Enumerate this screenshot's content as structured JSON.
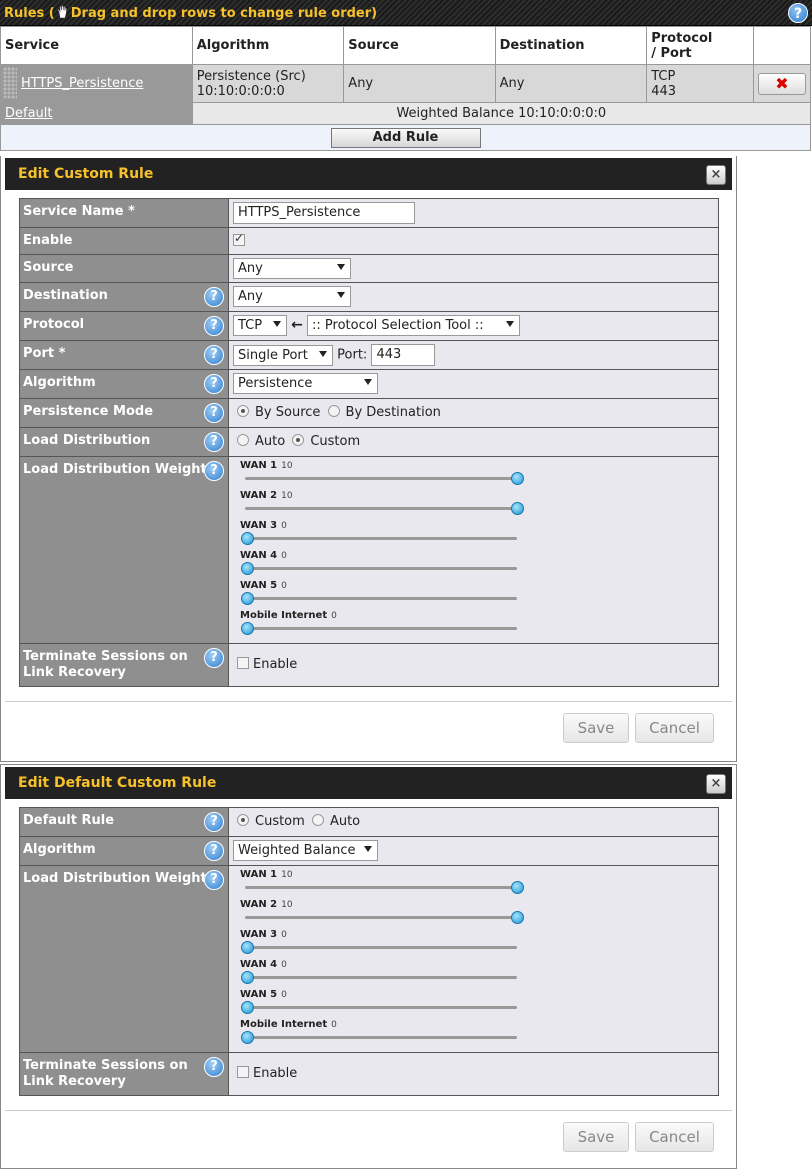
{
  "rules_bar": {
    "title": "Rules",
    "hint": "Drag and drop rows to change rule order",
    "help": "?"
  },
  "rules_table": {
    "headers": [
      "Service",
      "Algorithm",
      "Source",
      "Destination",
      "Protocol / Port"
    ],
    "header_protocol_line1": "Protocol",
    "header_protocol_line2": "/ Port",
    "rows": [
      {
        "service": "HTTPS_Persistence",
        "algorithm_line1": "Persistence (Src)",
        "algorithm_line2": "10:10:0:0:0:0",
        "source": "Any",
        "destination": "Any",
        "protocol": "TCP",
        "port": "443",
        "delete": "✖"
      }
    ],
    "default_label": "Default",
    "default_value": "Weighted Balance 10:10:0:0:0:0",
    "add_rule": "Add Rule"
  },
  "custom_rule": {
    "title": "Edit Custom Rule",
    "close": "×",
    "labels": {
      "service_name": "Service Name *",
      "enable": "Enable",
      "source": "Source",
      "destination": "Destination",
      "protocol": "Protocol",
      "port": "Port *",
      "algorithm": "Algorithm",
      "persistence_mode": "Persistence Mode",
      "load_distribution": "Load Distribution",
      "load_distribution_weight": "Load Distribution Weight",
      "terminate_line1": "Terminate Sessions on",
      "terminate_line2": "Link Recovery"
    },
    "values": {
      "service_name": "HTTPS_Persistence",
      "enable_checked": true,
      "source": "Any",
      "destination": "Any",
      "protocol": "TCP",
      "protocol_arrow": "🡐",
      "protocol_tool": ":: Protocol Selection Tool ::",
      "port_mode": "Single Port",
      "port_label": "Port:",
      "port": "443",
      "algorithm": "Persistence",
      "persistence_by_source": "By Source",
      "persistence_by_destination": "By Destination",
      "persistence_selected": "By Source",
      "ld_auto": "Auto",
      "ld_custom": "Custom",
      "ld_selected": "Custom",
      "terminate_enable": "Enable"
    },
    "weights": [
      {
        "name": "WAN 1",
        "value": "10"
      },
      {
        "name": "WAN 2",
        "value": "10"
      },
      {
        "name": "WAN 3",
        "value": "0"
      },
      {
        "name": "WAN 4",
        "value": "0"
      },
      {
        "name": "WAN 5",
        "value": "0"
      },
      {
        "name": "Mobile Internet",
        "value": "0"
      }
    ],
    "save": "Save",
    "cancel": "Cancel"
  },
  "default_rule": {
    "title": "Edit Default Custom Rule",
    "close": "×",
    "labels": {
      "default_rule": "Default Rule",
      "algorithm": "Algorithm",
      "load_distribution_weight": "Load Distribution Weight",
      "terminate_line1": "Terminate Sessions on",
      "terminate_line2": "Link Recovery"
    },
    "values": {
      "custom": "Custom",
      "auto": "Auto",
      "selected": "Custom",
      "algorithm": "Weighted Balance",
      "terminate_enable": "Enable"
    },
    "weights": [
      {
        "name": "WAN 1",
        "value": "10"
      },
      {
        "name": "WAN 2",
        "value": "10"
      },
      {
        "name": "WAN 3",
        "value": "0"
      },
      {
        "name": "WAN 4",
        "value": "0"
      },
      {
        "name": "WAN 5",
        "value": "0"
      },
      {
        "name": "Mobile Internet",
        "value": "0"
      }
    ],
    "save": "Save",
    "cancel": "Cancel"
  },
  "colors": {
    "accent_yellow": "#f6c12a",
    "header_dark": "#222222",
    "label_grey": "#8f8f8f",
    "slider_knob": "#1a94d2"
  }
}
